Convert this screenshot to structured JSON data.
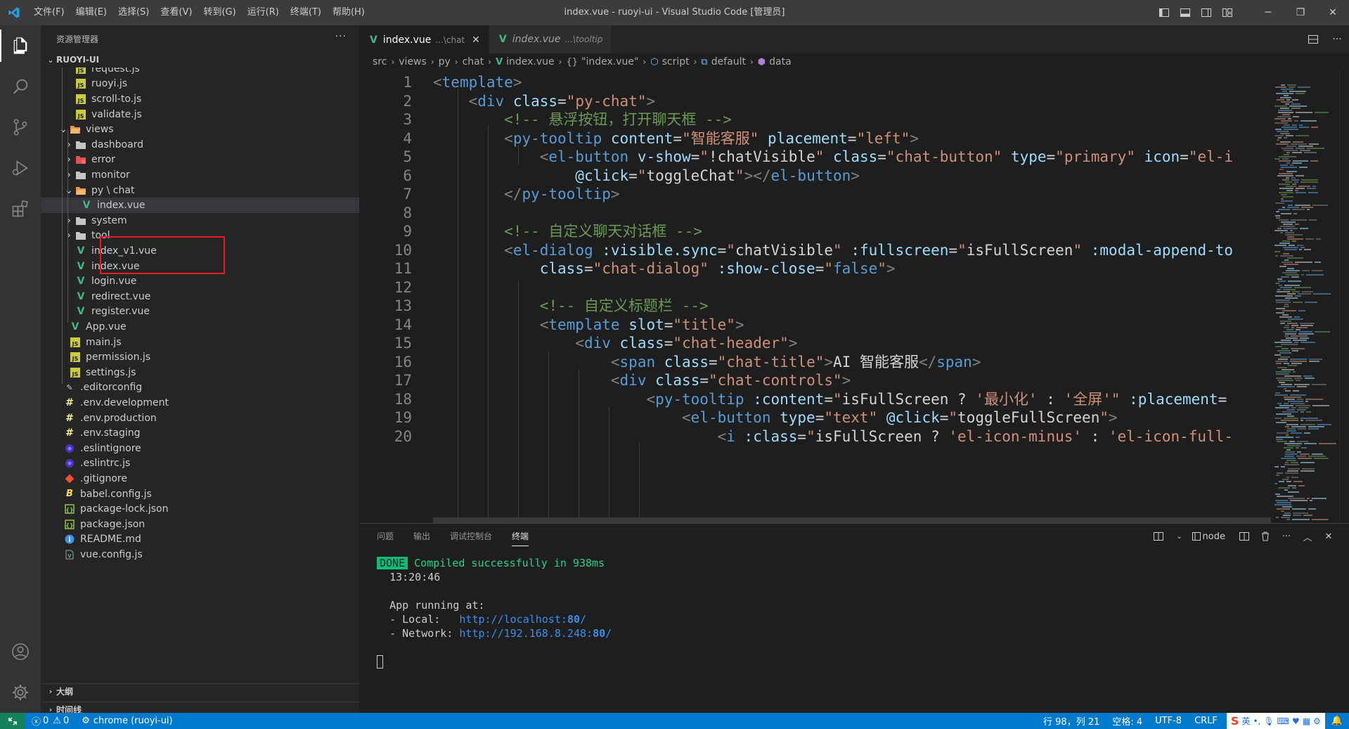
{
  "titlebar": {
    "menus": [
      "文件(F)",
      "编辑(E)",
      "选择(S)",
      "查看(V)",
      "转到(G)",
      "运行(R)",
      "终端(T)",
      "帮助(H)"
    ],
    "title": "index.vue - ruoyi-ui - Visual Studio Code [管理员]"
  },
  "sidebar": {
    "header": "资源管理器",
    "more": "···",
    "root": "RUOYI-UI",
    "items": [
      {
        "label": "request.js",
        "icon": "js-icon",
        "depth": 3,
        "type": "file"
      },
      {
        "label": "ruoyi.js",
        "icon": "js-icon",
        "depth": 3,
        "type": "file"
      },
      {
        "label": "scroll-to.js",
        "icon": "js-icon",
        "depth": 3,
        "type": "file"
      },
      {
        "label": "validate.js",
        "icon": "js-icon",
        "depth": 3,
        "type": "file"
      },
      {
        "label": "views",
        "icon": "folder-open-icon",
        "depth": 2,
        "type": "folder-open"
      },
      {
        "label": "dashboard",
        "icon": "folder-icon",
        "depth": 3,
        "type": "folder"
      },
      {
        "label": "error",
        "icon": "folder-error-icon",
        "depth": 3,
        "type": "folder"
      },
      {
        "label": "monitor",
        "icon": "folder-icon",
        "depth": 3,
        "type": "folder"
      },
      {
        "label": "py \\ chat",
        "icon": "folder-open-icon",
        "depth": 3,
        "type": "folder-open"
      },
      {
        "label": "index.vue",
        "icon": "vue-icon",
        "depth": 4,
        "type": "file",
        "selected": true
      },
      {
        "label": "system",
        "icon": "folder-icon",
        "depth": 3,
        "type": "folder"
      },
      {
        "label": "tool",
        "icon": "folder-icon",
        "depth": 3,
        "type": "folder"
      },
      {
        "label": "index_v1.vue",
        "icon": "vue-icon",
        "depth": 3,
        "type": "file"
      },
      {
        "label": "index.vue",
        "icon": "vue-icon",
        "depth": 3,
        "type": "file"
      },
      {
        "label": "login.vue",
        "icon": "vue-icon",
        "depth": 3,
        "type": "file"
      },
      {
        "label": "redirect.vue",
        "icon": "vue-icon",
        "depth": 3,
        "type": "file"
      },
      {
        "label": "register.vue",
        "icon": "vue-icon",
        "depth": 3,
        "type": "file"
      },
      {
        "label": "App.vue",
        "icon": "vue-icon",
        "depth": 2,
        "type": "file"
      },
      {
        "label": "main.js",
        "icon": "js-icon",
        "depth": 2,
        "type": "file"
      },
      {
        "label": "permission.js",
        "icon": "js-icon",
        "depth": 2,
        "type": "file"
      },
      {
        "label": "settings.js",
        "icon": "js-icon",
        "depth": 2,
        "type": "file"
      },
      {
        "label": ".editorconfig",
        "icon": "editorconfig-icon",
        "depth": 1,
        "type": "file"
      },
      {
        "label": ".env.development",
        "icon": "env-icon",
        "depth": 1,
        "type": "file"
      },
      {
        "label": ".env.production",
        "icon": "env-icon",
        "depth": 1,
        "type": "file"
      },
      {
        "label": ".env.staging",
        "icon": "env-icon",
        "depth": 1,
        "type": "file"
      },
      {
        "label": ".eslintignore",
        "icon": "eslint-icon",
        "depth": 1,
        "type": "file"
      },
      {
        "label": ".eslintrc.js",
        "icon": "eslint-icon",
        "depth": 1,
        "type": "file"
      },
      {
        "label": ".gitignore",
        "icon": "git-icon",
        "depth": 1,
        "type": "file"
      },
      {
        "label": "babel.config.js",
        "icon": "babel-icon",
        "depth": 1,
        "type": "file"
      },
      {
        "label": "package-lock.json",
        "icon": "npm-icon",
        "depth": 1,
        "type": "file"
      },
      {
        "label": "package.json",
        "icon": "npm-icon",
        "depth": 1,
        "type": "file"
      },
      {
        "label": "README.md",
        "icon": "info-icon",
        "depth": 1,
        "type": "file"
      },
      {
        "label": "vue.config.js",
        "icon": "vueconfig-icon",
        "depth": 1,
        "type": "file"
      }
    ],
    "outline": "大纲",
    "timeline": "时间线"
  },
  "tabs": [
    {
      "label": "index.vue",
      "desc": "...\\chat",
      "active": true
    },
    {
      "label": "index.vue",
      "desc": "...\\tooltip",
      "active": false
    }
  ],
  "breadcrumb": [
    "src",
    "views",
    "py",
    "chat",
    "index.vue",
    "\"index.vue\"",
    "script",
    "default",
    "data"
  ],
  "code": [
    [
      [
        "t-punc",
        "<"
      ],
      [
        "t-tag",
        "template"
      ],
      [
        "t-punc",
        ">"
      ]
    ],
    [
      [
        "t-txt",
        "    "
      ],
      [
        "t-punc",
        "<"
      ],
      [
        "t-tag",
        "div"
      ],
      [
        "t-txt",
        " "
      ],
      [
        "t-attr",
        "class"
      ],
      [
        "t-txt",
        "="
      ],
      [
        "t-str",
        "\"py-chat\""
      ],
      [
        "t-punc",
        ">"
      ]
    ],
    [
      [
        "t-txt",
        "        "
      ],
      [
        "t-com",
        "<!-- 悬浮按钮，打开聊天框 -->"
      ]
    ],
    [
      [
        "t-txt",
        "        "
      ],
      [
        "t-punc",
        "<"
      ],
      [
        "t-tag",
        "py-tooltip"
      ],
      [
        "t-txt",
        " "
      ],
      [
        "t-attr",
        "content"
      ],
      [
        "t-txt",
        "="
      ],
      [
        "t-str",
        "\"智能客服\""
      ],
      [
        "t-txt",
        " "
      ],
      [
        "t-attr",
        "placement"
      ],
      [
        "t-txt",
        "="
      ],
      [
        "t-str",
        "\"left\""
      ],
      [
        "t-punc",
        ">"
      ]
    ],
    [
      [
        "t-txt",
        "            "
      ],
      [
        "t-punc",
        "<"
      ],
      [
        "t-tag",
        "el-button"
      ],
      [
        "t-txt",
        " "
      ],
      [
        "t-attr",
        "v-show"
      ],
      [
        "t-txt",
        "="
      ],
      [
        "t-str",
        "\""
      ],
      [
        "t-txt",
        "!chatVisible"
      ],
      [
        "t-str",
        "\""
      ],
      [
        "t-txt",
        " "
      ],
      [
        "t-attr",
        "class"
      ],
      [
        "t-txt",
        "="
      ],
      [
        "t-str",
        "\"chat-button\""
      ],
      [
        "t-txt",
        " "
      ],
      [
        "t-attr",
        "type"
      ],
      [
        "t-txt",
        "="
      ],
      [
        "t-str",
        "\"primary\""
      ],
      [
        "t-txt",
        " "
      ],
      [
        "t-attr",
        "icon"
      ],
      [
        "t-txt",
        "="
      ],
      [
        "t-str",
        "\"el-i"
      ]
    ],
    [
      [
        "t-txt",
        "                "
      ],
      [
        "t-attr",
        "@click"
      ],
      [
        "t-txt",
        "="
      ],
      [
        "t-str",
        "\""
      ],
      [
        "t-txt",
        "toggleChat"
      ],
      [
        "t-str",
        "\""
      ],
      [
        "t-punc",
        "></"
      ],
      [
        "t-tag",
        "el-button"
      ],
      [
        "t-punc",
        ">"
      ]
    ],
    [
      [
        "t-txt",
        "        "
      ],
      [
        "t-punc",
        "</"
      ],
      [
        "t-tag",
        "py-tooltip"
      ],
      [
        "t-punc",
        ">"
      ]
    ],
    [],
    [
      [
        "t-txt",
        "        "
      ],
      [
        "t-com",
        "<!-- 自定义聊天对话框 -->"
      ]
    ],
    [
      [
        "t-txt",
        "        "
      ],
      [
        "t-punc",
        "<"
      ],
      [
        "t-tag",
        "el-dialog"
      ],
      [
        "t-txt",
        " "
      ],
      [
        "t-attr",
        ":visible.sync"
      ],
      [
        "t-txt",
        "="
      ],
      [
        "t-str",
        "\""
      ],
      [
        "t-txt",
        "chatVisible"
      ],
      [
        "t-str",
        "\""
      ],
      [
        "t-txt",
        " "
      ],
      [
        "t-attr",
        ":fullscreen"
      ],
      [
        "t-txt",
        "="
      ],
      [
        "t-str",
        "\""
      ],
      [
        "t-txt",
        "isFullScreen"
      ],
      [
        "t-str",
        "\""
      ],
      [
        "t-txt",
        " "
      ],
      [
        "t-attr",
        ":modal-append-to"
      ]
    ],
    [
      [
        "t-txt",
        "            "
      ],
      [
        "t-attr",
        "class"
      ],
      [
        "t-txt",
        "="
      ],
      [
        "t-str",
        "\"chat-dialog\""
      ],
      [
        "t-txt",
        " "
      ],
      [
        "t-attr",
        ":show-close"
      ],
      [
        "t-txt",
        "="
      ],
      [
        "t-str",
        "\""
      ],
      [
        "t-tag",
        "false"
      ],
      [
        "t-str",
        "\""
      ],
      [
        "t-punc",
        ">"
      ]
    ],
    [],
    [
      [
        "t-txt",
        "            "
      ],
      [
        "t-com",
        "<!-- 自定义标题栏 -->"
      ]
    ],
    [
      [
        "t-txt",
        "            "
      ],
      [
        "t-punc",
        "<"
      ],
      [
        "t-tag",
        "template"
      ],
      [
        "t-txt",
        " "
      ],
      [
        "t-attr",
        "slot"
      ],
      [
        "t-txt",
        "="
      ],
      [
        "t-str",
        "\"title\""
      ],
      [
        "t-punc",
        ">"
      ]
    ],
    [
      [
        "t-txt",
        "                "
      ],
      [
        "t-punc",
        "<"
      ],
      [
        "t-tag",
        "div"
      ],
      [
        "t-txt",
        " "
      ],
      [
        "t-attr",
        "class"
      ],
      [
        "t-txt",
        "="
      ],
      [
        "t-str",
        "\"chat-header\""
      ],
      [
        "t-punc",
        ">"
      ]
    ],
    [
      [
        "t-txt",
        "                    "
      ],
      [
        "t-punc",
        "<"
      ],
      [
        "t-tag",
        "span"
      ],
      [
        "t-txt",
        " "
      ],
      [
        "t-attr",
        "class"
      ],
      [
        "t-txt",
        "="
      ],
      [
        "t-str",
        "\"chat-title\""
      ],
      [
        "t-punc",
        ">"
      ],
      [
        "t-txt",
        "AI 智能客服"
      ],
      [
        "t-punc",
        "</"
      ],
      [
        "t-tag",
        "span"
      ],
      [
        "t-punc",
        ">"
      ]
    ],
    [
      [
        "t-txt",
        "                    "
      ],
      [
        "t-punc",
        "<"
      ],
      [
        "t-tag",
        "div"
      ],
      [
        "t-txt",
        " "
      ],
      [
        "t-attr",
        "class"
      ],
      [
        "t-txt",
        "="
      ],
      [
        "t-str",
        "\"chat-controls\""
      ],
      [
        "t-punc",
        ">"
      ]
    ],
    [
      [
        "t-txt",
        "                        "
      ],
      [
        "t-punc",
        "<"
      ],
      [
        "t-tag",
        "py-tooltip"
      ],
      [
        "t-txt",
        " "
      ],
      [
        "t-attr",
        ":content"
      ],
      [
        "t-txt",
        "="
      ],
      [
        "t-str",
        "\""
      ],
      [
        "t-txt",
        "isFullScreen ? "
      ],
      [
        "t-str",
        "'最小化'"
      ],
      [
        "t-txt",
        " : "
      ],
      [
        "t-str",
        "'全屏'"
      ],
      [
        "t-str",
        "\""
      ],
      [
        "t-txt",
        " "
      ],
      [
        "t-attr",
        ":placement"
      ],
      [
        "t-txt",
        "="
      ]
    ],
    [
      [
        "t-txt",
        "                            "
      ],
      [
        "t-punc",
        "<"
      ],
      [
        "t-tag",
        "el-button"
      ],
      [
        "t-txt",
        " "
      ],
      [
        "t-attr",
        "type"
      ],
      [
        "t-txt",
        "="
      ],
      [
        "t-str",
        "\"text\""
      ],
      [
        "t-txt",
        " "
      ],
      [
        "t-attr",
        "@click"
      ],
      [
        "t-txt",
        "="
      ],
      [
        "t-str",
        "\""
      ],
      [
        "t-txt",
        "toggleFullScreen"
      ],
      [
        "t-str",
        "\""
      ],
      [
        "t-punc",
        ">"
      ]
    ],
    [
      [
        "t-txt",
        "                                "
      ],
      [
        "t-punc",
        "<"
      ],
      [
        "t-tag",
        "i"
      ],
      [
        "t-txt",
        " "
      ],
      [
        "t-attr",
        ":class"
      ],
      [
        "t-txt",
        "="
      ],
      [
        "t-str",
        "\""
      ],
      [
        "t-txt",
        "isFullScreen ? "
      ],
      [
        "t-str",
        "'el-icon-minus'"
      ],
      [
        "t-txt",
        " : "
      ],
      [
        "t-str",
        "'el-icon-full-"
      ]
    ]
  ],
  "panel": {
    "tabs": [
      "问题",
      "输出",
      "调试控制台",
      "终端"
    ],
    "terminal_name": "node",
    "done": "DONE",
    "compiled": "Compiled successfully in 938ms",
    "time": "13:20:46",
    "app_running": "App running at:",
    "local_label": "- Local:   ",
    "local_url": "http://localhost:",
    "local_port": "80",
    "network_label": "- Network: ",
    "network_url": "http://192.168.8.248:",
    "network_port": "80"
  },
  "statusbar": {
    "errors": "0",
    "warnings": "0",
    "debug": "chrome (ruoyi-ui)",
    "position": "行 98，列 21",
    "spaces": "空格: 4",
    "encoding": "UTF-8",
    "eol": "CRLF",
    "ime_lang": "英"
  },
  "colors": {
    "vue": "#41b883",
    "js": "#cbcb41",
    "folder": "#c5c5c5",
    "accent": "#007acc",
    "highlight": "#e51c23"
  }
}
